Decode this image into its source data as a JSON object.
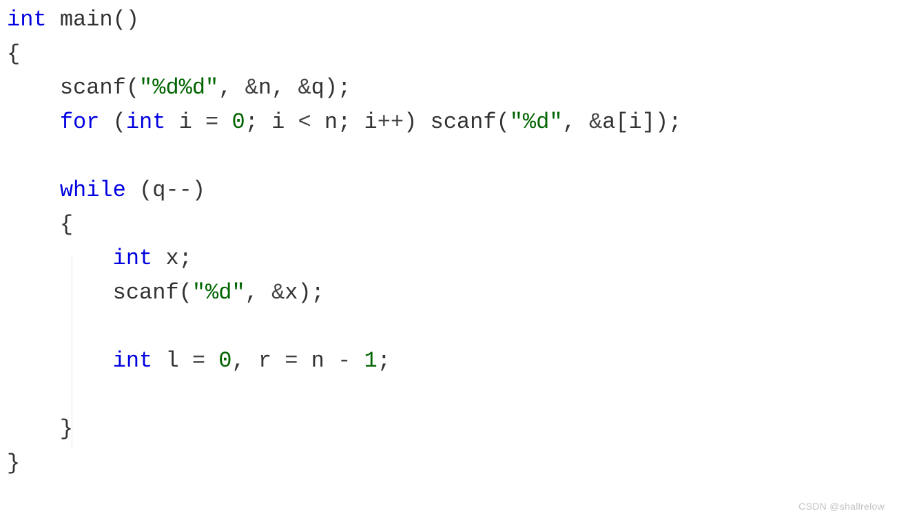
{
  "code": {
    "type_int": "int",
    "main": "main",
    "paren_open": "(",
    "paren_close": ")",
    "brace_open": "{",
    "brace_close": "}",
    "scanf": "scanf",
    "fmt_dd": "\"%d%d\"",
    "fmt_d": "\"%d\"",
    "comma": ",",
    "amp": "&",
    "n": "n",
    "q": "q",
    "a": "a",
    "i": "i",
    "x": "x",
    "l": "l",
    "r": "r",
    "semi": ";",
    "for_kw": "for",
    "while_kw": "while",
    "eq": "=",
    "zero": "0",
    "one": "1",
    "lt": "<",
    "inc": "++",
    "dec": "--",
    "minus": "-",
    "lbracket": "[",
    "rbracket": "]"
  },
  "watermark": "CSDN @shallrelow"
}
